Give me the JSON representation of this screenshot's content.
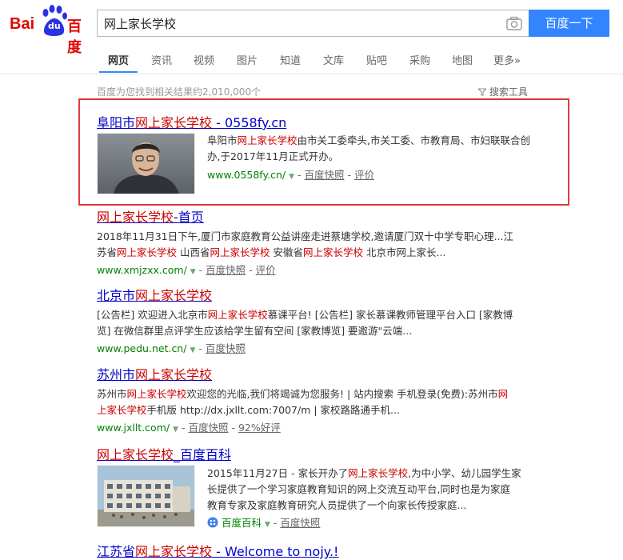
{
  "logo": {
    "bai": "Bai",
    "du": "du",
    "cn": "百度"
  },
  "search": {
    "query": "网上家长学校",
    "button": "百度一下"
  },
  "tabs": [
    "网页",
    "资讯",
    "视频",
    "图片",
    "知道",
    "文库",
    "贴吧",
    "采购",
    "地图",
    "更多»"
  ],
  "meta": {
    "result_count": "百度为您找到相关结果约2,010,000个",
    "tools": "搜索工具"
  },
  "results": [
    {
      "title_a": "阜阳市",
      "title_em": "网上家长学校",
      "title_b": " - 0558fy.cn",
      "desc_a": "阜阳市",
      "desc_em": "网上家长学校",
      "desc_b": "由市关工委牵头,市关工委、市教育局、市妇联联合创办,于2017年11月正式开办。",
      "url": "www.0558fy.cn/",
      "links": [
        "百度快照",
        "评价"
      ]
    },
    {
      "title_em": "网上家长学校",
      "title_b": "-首页",
      "desc_line1": "2018年11月31日下午,厦门市家庭教育公益讲座走进蔡塘学校,邀请厦门双十中学专职心理...江",
      "desc_a": "苏省",
      "desc_em1": "网上家长学校",
      "desc_b": " 山西省",
      "desc_em2": "网上家长学校",
      "desc_c": " 安徽省",
      "desc_em3": "网上家长学校",
      "desc_d": " 北京市网上家长...",
      "url": "www.xmjzxx.com/",
      "links": [
        "百度快照",
        "评价"
      ]
    },
    {
      "title_a": "北京市",
      "title_em": "网上家长学校",
      "desc_a": "[公告栏] 欢迎进入北京市",
      "desc_em": "网上家长学校",
      "desc_b": "慕课平台! [公告栏] 家长慕课教师管理平台入口 [家教博",
      "desc_line2": "览] 在微信群里点评学生应该给学生留有空间 [家教博览] 要邀游\"云端...",
      "url": "www.pedu.net.cn/",
      "links": [
        "百度快照"
      ]
    },
    {
      "title_a": "苏州市",
      "title_em": "网上家长学校",
      "desc_a": "苏州市",
      "desc_em": "网上家长学校",
      "desc_b": "欢迎您的光临,我们将竭诚为您服务! | 站内搜索 手机登录(免费):苏州市",
      "desc_em2": "网",
      "desc_em3": "上家长学校",
      "desc_c": "手机版 http://dx.jxllt.com:7007/m | 家校路路通手机...",
      "url": "www.jxllt.com/",
      "links": [
        "百度快照",
        "92%好评"
      ]
    },
    {
      "title_em": "网上家长学校",
      "title_b": "_百度百科",
      "desc_a": "2015年11月27日 - 家长开办了",
      "desc_em": "网上家长学校",
      "desc_b": ",为中小学、幼儿园学生家",
      "desc_line2": "长提供了一个学习家庭教育知识的网上交流互动平台,同时也是为家庭",
      "desc_line3": "教育专家及家庭教育研究人员提供了一个向家长传授家庭...",
      "source": "百度百科",
      "links": [
        "百度快照"
      ]
    }
  ],
  "cutoff": {
    "text_a": "江苏省",
    "text_em": "网上家长学校",
    "text_b": " - Welcome to nojy.!"
  },
  "colors": {
    "accent": "#3385ff",
    "brand": "#e10602",
    "link": "#0000cc",
    "highlight": "#cc0000",
    "url": "#008000",
    "box": "#e0393e"
  }
}
